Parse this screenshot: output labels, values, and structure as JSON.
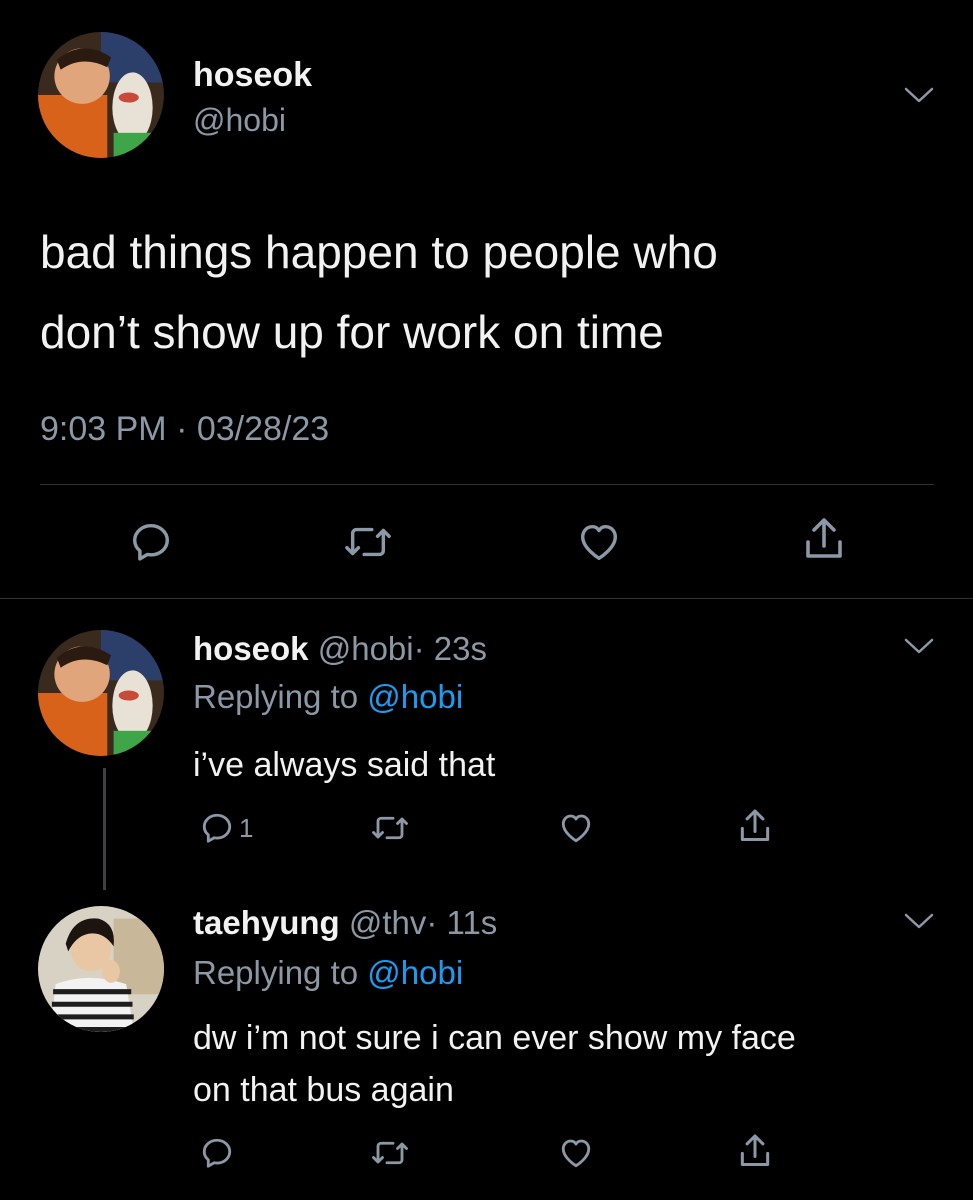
{
  "main_tweet": {
    "author_name": "hoseok",
    "author_handle": "@hobi",
    "text_line1": "bad things happen to people who",
    "text_line2": "don’t show up for work on time",
    "timestamp": "9:03 PM · 03/28/23"
  },
  "replies": [
    {
      "author_name": "hoseok",
      "author_handle": "@hobi",
      "time": "· 23s",
      "replying_prefix": "Replying to",
      "replying_to": "@hobi",
      "text_line1": "i’ve always said that",
      "text_line2": "",
      "reply_count": "1"
    },
    {
      "author_name": "taehyung",
      "author_handle": "@thv",
      "time": "· 11s",
      "replying_prefix": "Replying to",
      "replying_to": "@hobi",
      "text_line1": "dw i’m not sure i can ever show my face",
      "text_line2": "on that bus again",
      "reply_count": ""
    }
  ],
  "icons": {
    "reply": "reply-icon",
    "retweet": "retweet-icon",
    "like": "heart-icon",
    "share": "share-icon",
    "menu": "chevron-down-icon"
  },
  "colors": {
    "background": "#000000",
    "text": "#e7e9ea",
    "muted": "#8b98a5",
    "link": "#1d9bf0",
    "divider": "#2f3336"
  }
}
